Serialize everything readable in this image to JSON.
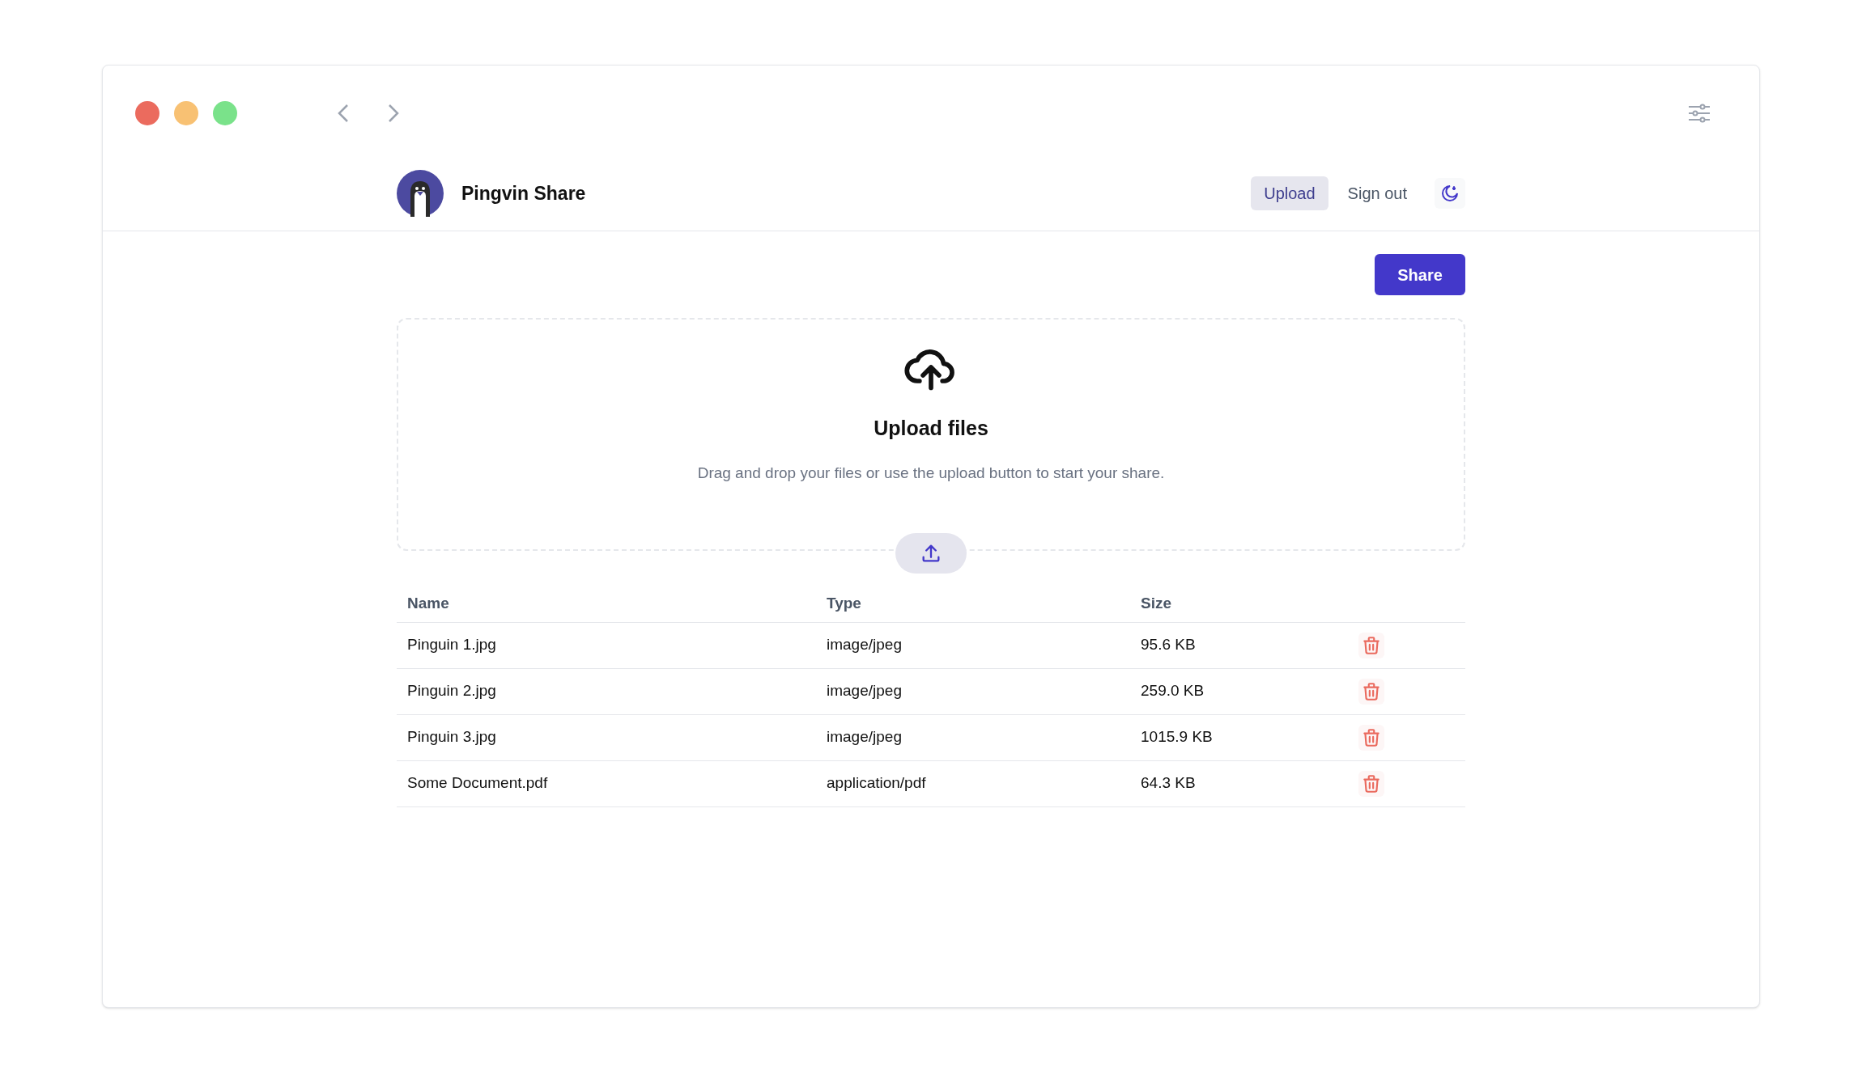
{
  "app": {
    "title": "Pingvin Share"
  },
  "nav": [
    {
      "label": "Upload",
      "selected": true
    },
    {
      "label": "Sign out",
      "selected": false
    }
  ],
  "share_button": "Share",
  "dropzone": {
    "title": "Upload files",
    "description": "Drag and drop your files or use the upload button to start your share."
  },
  "table": {
    "columns": [
      "Name",
      "Type",
      "Size"
    ],
    "rows": [
      [
        "Pinguin 1.jpg",
        "image/jpeg",
        "95.6 KB"
      ],
      [
        "Pinguin 2.jpg",
        "image/jpeg",
        "259.0 KB"
      ],
      [
        "Pinguin 3.jpg",
        "image/jpeg",
        "1015.9 KB"
      ],
      [
        "Some Document.pdf",
        "application/pdf",
        "64.3 KB"
      ]
    ]
  }
}
